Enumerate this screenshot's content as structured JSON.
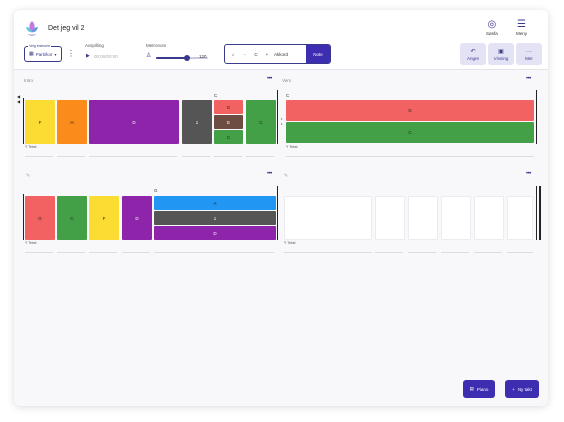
{
  "app": {
    "title": "Det jeg vil 2"
  },
  "nav": {
    "search_label": "Søsfa",
    "menu_label": "Meny"
  },
  "controls": {
    "part_label": "Velg instrume",
    "part_value": "Parti/kor",
    "playback_label": "Avspilling",
    "timer": "00:00/00:00",
    "metronome_label": "Metronom",
    "bpm": "120",
    "metronome_level": 0.6
  },
  "chord_entry": {
    "key_value": "C",
    "chord_label": "Akkord",
    "note_label": "Note"
  },
  "toolbar": {
    "undo_label": "Angre",
    "view_label": "Visning",
    "more_label": "Mer"
  },
  "sections": {
    "intro": {
      "label": "Intro",
      "blocks": [
        "F",
        "H",
        "D",
        "1",
        "C"
      ],
      "stack_top_chord": "C",
      "stack": [
        "G",
        "E",
        "C"
      ],
      "text_label": "Ÿ Tekst"
    },
    "vers": {
      "label": "Vers",
      "top_chord": "C",
      "stack": [
        "G",
        "C"
      ],
      "text_label": "Ÿ Tekst"
    },
    "third": {
      "blocks": [
        "G",
        "C",
        "F",
        "D"
      ],
      "stack_top_chord": "G",
      "stack": [
        "A",
        "1",
        "D"
      ],
      "text_label": "Ÿ Tekst"
    },
    "fourth": {
      "text_label": "Ÿ Tekst"
    }
  },
  "fabs": {
    "piano_label": "Piano",
    "add_label": "Ny takt"
  },
  "colors": {
    "accent": "#3d2db0",
    "yellow": "#fcdb32",
    "orange": "#fb8c1b",
    "purple": "#8e24aa",
    "gray": "#555555",
    "red": "#f26262",
    "brown": "#6d4c41",
    "green": "#43a047",
    "blue": "#2196f3"
  }
}
